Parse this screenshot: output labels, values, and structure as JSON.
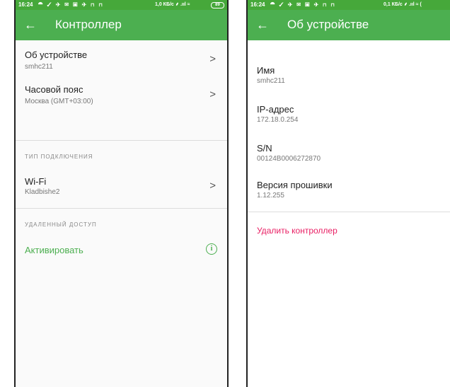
{
  "left": {
    "status": {
      "time": "16:24",
      "icons": "⯊ ✓ ✈ ✉ ▣ ✈ ⊓ ⊓",
      "net": "1,0 КБ/с ⸙ .ııl ≈",
      "battery": "89"
    },
    "toolbar": {
      "back": "←",
      "title": "Контроллер"
    },
    "items": [
      {
        "title": "Об устройстве",
        "subtitle": "smhc211"
      },
      {
        "title": "Часовой пояс",
        "subtitle": "Москва (GMT+03:00)"
      }
    ],
    "connection": {
      "header": "ТИП ПОДКЛЮЧЕНИЯ",
      "title": "Wi-Fi",
      "subtitle": "Kladbishe2"
    },
    "remote": {
      "header": "УДАЛЕННЫЙ ДОСТУП",
      "action": "Активировать"
    }
  },
  "right": {
    "status": {
      "time": "16:24",
      "icons": "⯊ ✓ ✈ ✉ ▣ ✈ ⊓ ⊓",
      "net": "0,1 КБ/с ⸙ .ııl ≈ ("
    },
    "toolbar": {
      "back": "←",
      "title": "Об устройстве"
    },
    "fields": [
      {
        "label": "Имя",
        "value": "smhc211"
      },
      {
        "label": "IP-адрес",
        "value": "172.18.0.254"
      },
      {
        "label": "S/N",
        "value": "00124B0006272870"
      },
      {
        "label": "Версия прошивки",
        "value": "1.12.255"
      }
    ],
    "delete_label": "Удалить контроллер"
  },
  "colors": {
    "statusbar": "#46a83a",
    "toolbar": "#4caf50",
    "accent_green": "#4caf50",
    "delete_pink": "#e91e63"
  }
}
